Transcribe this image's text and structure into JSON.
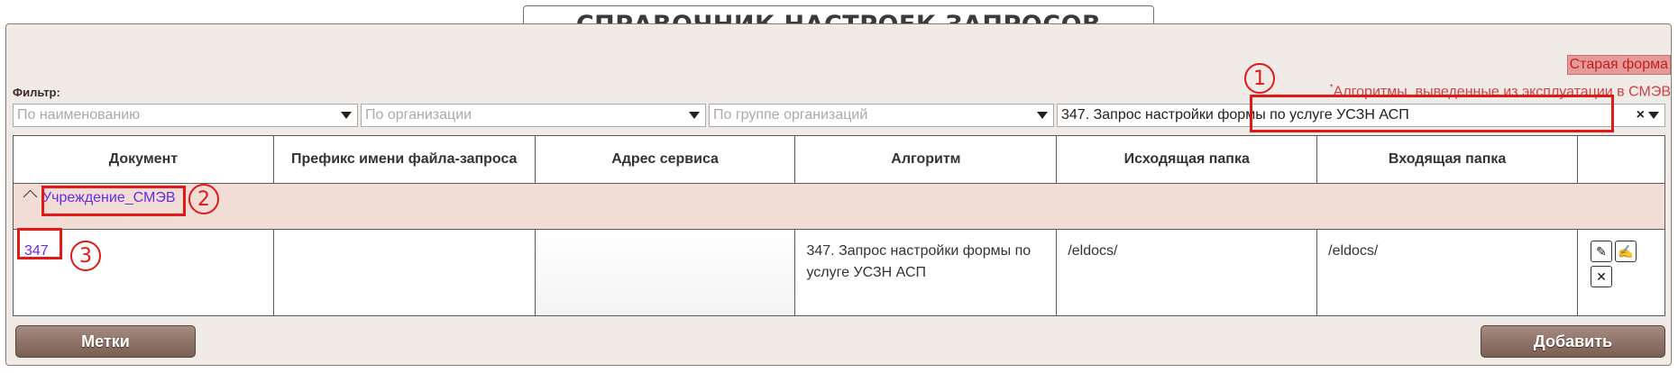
{
  "title": "СПРАВОЧНИК НАСТРОЕК ЗАПРОСОВ",
  "filter_label": "Фильтр:",
  "old_form_button": "Старая форма",
  "algo_note_mark": "*",
  "algo_note": "Алгоритмы, выведенные из эксплуатации в СМЭВ",
  "filters": {
    "name_placeholder": "По наименованию",
    "org_placeholder": "По организации",
    "group_placeholder": "По группе организаций",
    "algo_value": "347. Запрос настройки формы по услуге УСЗН АСП",
    "clear_symbol": "×"
  },
  "table": {
    "headers": [
      "Документ",
      "Префикс имени файла-запроса",
      "Адрес сервиса",
      "Алгоритм",
      "Исходящая папка",
      "Входящая папка",
      ""
    ],
    "group": {
      "name": "Учреждение_СМЭВ"
    },
    "rows": [
      {
        "document": "347",
        "prefix": "",
        "service": "",
        "algorithm": "347. Запрос настройки формы по услуге УСЗН АСП",
        "out_folder": "/eldocs/",
        "in_folder": "/eldocs/"
      }
    ]
  },
  "annotations": [
    "1",
    "2",
    "3"
  ],
  "buttons": {
    "labels": "Метки",
    "add": "Добавить"
  },
  "icons": {
    "edit": "✎",
    "notes": "✍",
    "delete": "✕"
  },
  "colors": {
    "panel_bg": "#f1ebe7",
    "group_bg": "#f1dcd6",
    "button": "#8b6d62",
    "link": "#6a2ae6",
    "annotation": "#e01818"
  }
}
